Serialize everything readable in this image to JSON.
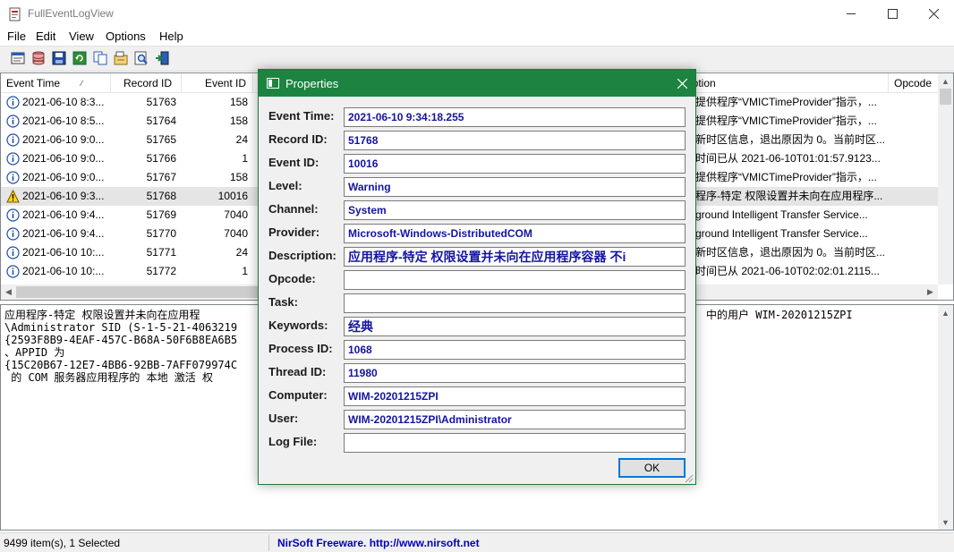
{
  "window": {
    "title": "FullEventLogView",
    "icon": "app-icon"
  },
  "menu": [
    "File",
    "Edit",
    "View",
    "Options",
    "Help"
  ],
  "toolbar": [
    "properties-icon",
    "database-icon",
    "save-icon",
    "refresh-icon",
    "copy-icon",
    "options-icon",
    "find-icon",
    "exit-icon"
  ],
  "list": {
    "columns": [
      {
        "label": "Event Time"
      },
      {
        "label": "Record ID"
      },
      {
        "label": "Event ID"
      },
      {
        "label": "ription"
      },
      {
        "label": "Opcode"
      }
    ],
    "rows": [
      {
        "time": "2021-06-10 8:3...",
        "record": "51763",
        "event": "158",
        "desc": "提供程序“VMICTimeProvider”指示，...",
        "level": "info"
      },
      {
        "time": "2021-06-10 8:5...",
        "record": "51764",
        "event": "158",
        "desc": "提供程序“VMICTimeProvider”指示，...",
        "level": "info"
      },
      {
        "time": "2021-06-10 9:0...",
        "record": "51765",
        "event": "24",
        "desc": "新时区信息，退出原因为 0。当前时区...",
        "level": "info"
      },
      {
        "time": "2021-06-10 9:0...",
        "record": "51766",
        "event": "1",
        "desc": "时间已从 2021-06-10T01:01:57.9123...",
        "level": "info"
      },
      {
        "time": "2021-06-10 9:0...",
        "record": "51767",
        "event": "158",
        "desc": "提供程序“VMICTimeProvider”指示，...",
        "level": "info"
      },
      {
        "time": "2021-06-10 9:3...",
        "record": "51768",
        "event": "10016",
        "desc": "程序-特定 权限设置并未向在应用程序...",
        "level": "warning",
        "selected": true
      },
      {
        "time": "2021-06-10 9:4...",
        "record": "51769",
        "event": "7040",
        "desc": "ground Intelligent Transfer Service...",
        "level": "info"
      },
      {
        "time": "2021-06-10 9:4...",
        "record": "51770",
        "event": "7040",
        "desc": "ground Intelligent Transfer Service...",
        "level": "info"
      },
      {
        "time": "2021-06-10 10:...",
        "record": "51771",
        "event": "24",
        "desc": "新时区信息，退出原因为 0。当前时区...",
        "level": "info"
      },
      {
        "time": "2021-06-10 10:...",
        "record": "51772",
        "event": "1",
        "desc": "时间已从 2021-06-10T02:02:01.2115...",
        "level": "info"
      }
    ]
  },
  "text_pane": {
    "lines": [
      "应用程序-特定 权限设置并未向在应用程",
      "\\Administrator SID (S-1-5-21-4063219",
      "{2593F8B9-4EAF-457C-B68A-50F6B8EA6B5",
      "、APPID 为",
      "{15C20B67-12E7-4BB6-92BB-7AFF079974C",
      " 的 COM 服务器应用程序的 本地 激活 权"
    ],
    "right_line": "中的用户 WIM-20201215ZPI"
  },
  "status": {
    "items": "9499 item(s), 1 Selected",
    "link": "NirSoft Freeware.  http://www.nirsoft.net"
  },
  "dialog": {
    "title": "Properties",
    "fields": [
      {
        "label": "Event Time:",
        "value": "2021-06-10 9:34:18.255"
      },
      {
        "label": "Record ID:",
        "value": "51768"
      },
      {
        "label": "Event ID:",
        "value": "10016"
      },
      {
        "label": "Level:",
        "value": "Warning"
      },
      {
        "label": "Channel:",
        "value": "System"
      },
      {
        "label": "Provider:",
        "value": "Microsoft-Windows-DistributedCOM"
      },
      {
        "label": "Description:",
        "value": "应用程序-特定 权限设置并未向在应用程序容器 不i"
      },
      {
        "label": "Opcode:",
        "value": ""
      },
      {
        "label": "Task:",
        "value": ""
      },
      {
        "label": "Keywords:",
        "value": "经典"
      },
      {
        "label": "Process ID:",
        "value": "1068"
      },
      {
        "label": "Thread ID:",
        "value": "11980"
      },
      {
        "label": "Computer:",
        "value": "WIM-20201215ZPI"
      },
      {
        "label": "User:",
        "value": "WIM-20201215ZPI\\Administrator"
      },
      {
        "label": "Log File:",
        "value": ""
      }
    ],
    "ok_label": "OK"
  },
  "colors": {
    "dialog_title": "#1c8341",
    "field_text": "#1414a0",
    "link": "#0000c0"
  }
}
